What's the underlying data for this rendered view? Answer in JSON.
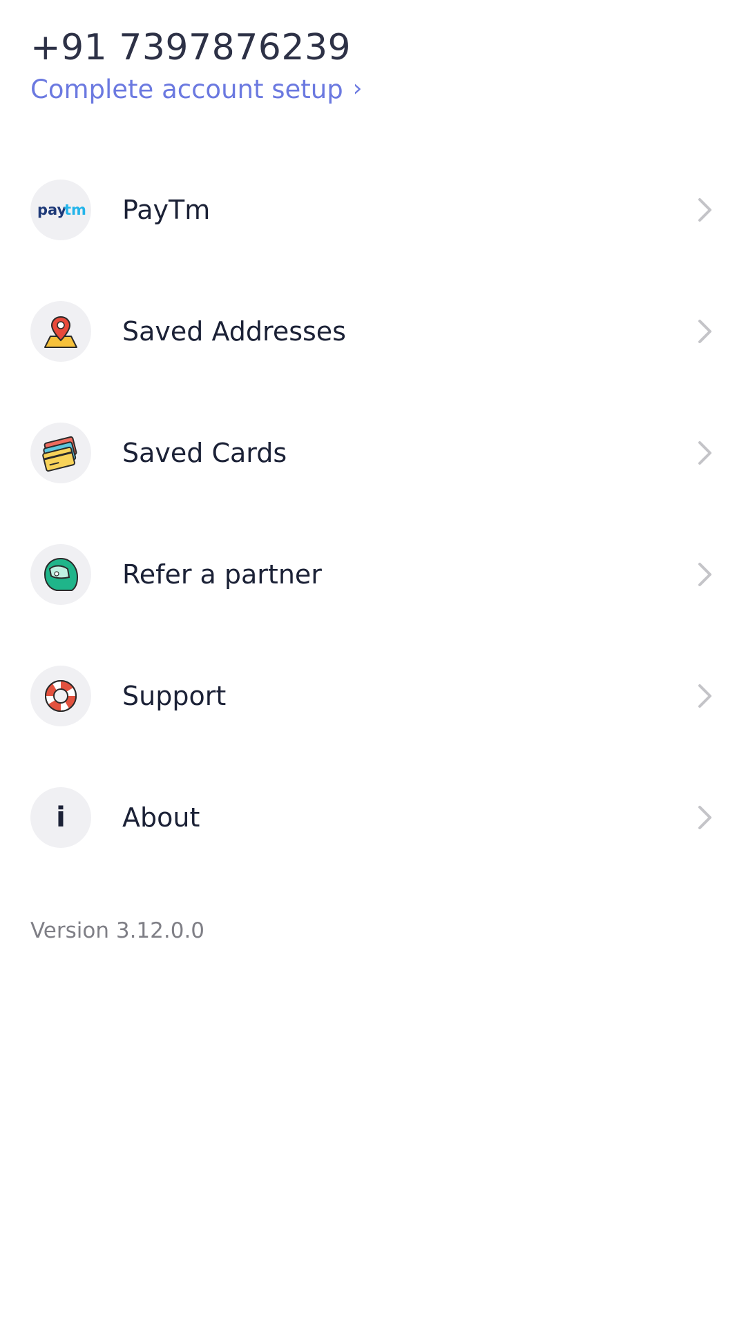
{
  "header": {
    "phone": "+91 7397876239",
    "setup_link": "Complete account setup",
    "setup_chevron": "›"
  },
  "menu": {
    "items": [
      {
        "label": "PayTm",
        "icon": "paytm-logo-icon"
      },
      {
        "label": "Saved Addresses",
        "icon": "map-pin-icon"
      },
      {
        "label": "Saved Cards",
        "icon": "credit-cards-icon"
      },
      {
        "label": "Refer a partner",
        "icon": "helmet-icon"
      },
      {
        "label": "Support",
        "icon": "lifebuoy-icon"
      },
      {
        "label": "About",
        "icon": "info-icon"
      }
    ]
  },
  "icons": {
    "paytm_text_1": "pay",
    "paytm_text_2": "tm",
    "info_glyph": "i"
  },
  "footer": {
    "version": "Version 3.12.0.0"
  },
  "colors": {
    "accent": "#6b79e0",
    "text": "#1b2136",
    "muted": "#7f7f86",
    "icon_bg": "#f0f0f3"
  }
}
